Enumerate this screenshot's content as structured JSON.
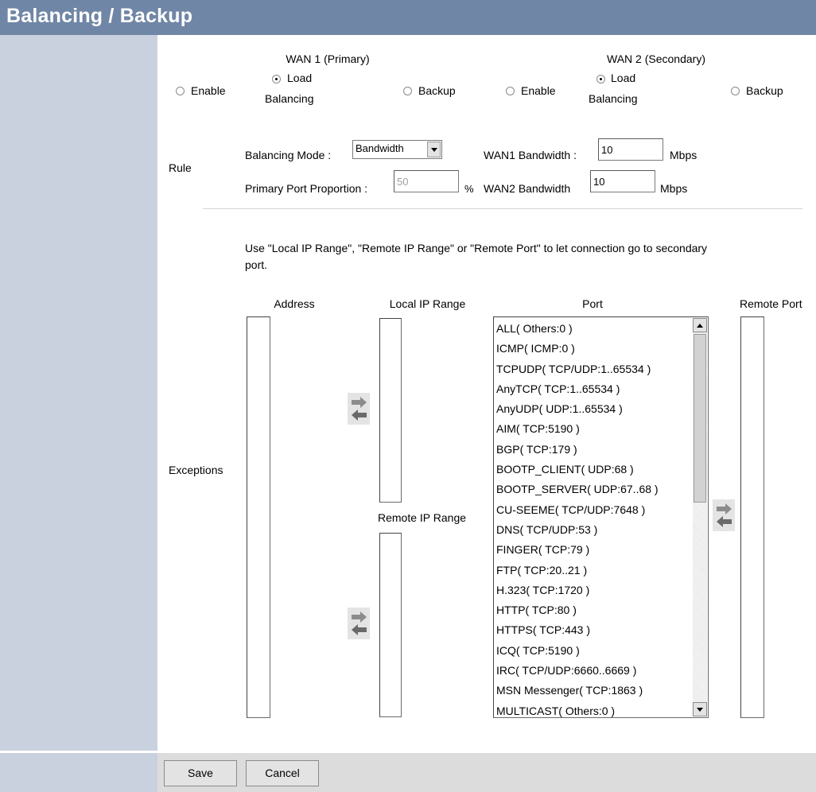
{
  "header": {
    "title": "Balancing / Backup"
  },
  "wan1": {
    "title": "WAN 1 (Primary)",
    "options": [
      {
        "label": "Enable",
        "checked": false
      },
      {
        "label_line1": "Load",
        "label_line2": "Balancing",
        "checked": true
      },
      {
        "label": "Backup",
        "checked": false
      }
    ]
  },
  "wan2": {
    "title": "WAN 2 (Secondary)",
    "options": [
      {
        "label": "Enable",
        "checked": false
      },
      {
        "label_line1": "Load",
        "label_line2": "Balancing",
        "checked": true
      },
      {
        "label": "Backup",
        "checked": false
      }
    ]
  },
  "rule": {
    "section_label": "Rule",
    "balancing_mode_label": "Balancing Mode :",
    "balancing_mode_value": "Bandwidth",
    "primary_port_proportion_label": "Primary Port Proportion :",
    "primary_port_proportion_value": "50",
    "percent_unit": "%",
    "wan1_bandwidth_label": "WAN1 Bandwidth :",
    "wan1_bandwidth_value": "10",
    "wan2_bandwidth_label": "WAN2 Bandwidth",
    "wan2_bandwidth_value": "10",
    "unit": "Mbps"
  },
  "exceptions": {
    "section_label": "Exceptions",
    "description_line1": "Use \"Local IP Range\", \"Remote IP Range\" or \"Remote Port\" to let connection go to secondary",
    "description_line2": "port.",
    "address_label": "Address",
    "local_ip_range_label": "Local IP Range",
    "remote_ip_range_label": "Remote IP Range",
    "port_label": "Port",
    "remote_port_label": "Remote Port",
    "ports": [
      "ALL( Others:0 )",
      "ICMP( ICMP:0 )",
      "TCPUDP( TCP/UDP:1..65534 )",
      "AnyTCP( TCP:1..65534 )",
      "AnyUDP( UDP:1..65534 )",
      "AIM( TCP:5190 )",
      "BGP( TCP:179 )",
      "BOOTP_CLIENT( UDP:68 )",
      "BOOTP_SERVER( UDP:67..68 )",
      "CU-SEEME( TCP/UDP:7648 )",
      "DNS( TCP/UDP:53 )",
      "FINGER( TCP:79 )",
      "FTP( TCP:20..21 )",
      "H.323( TCP:1720 )",
      "HTTP( TCP:80 )",
      "HTTPS( TCP:443 )",
      "ICQ( TCP:5190 )",
      "IRC( TCP/UDP:6660..6669 )",
      "MSN Messenger( TCP:1863 )",
      "MULTICAST( Others:0 )"
    ]
  },
  "footer": {
    "save_label": "Save",
    "cancel_label": "Cancel"
  }
}
